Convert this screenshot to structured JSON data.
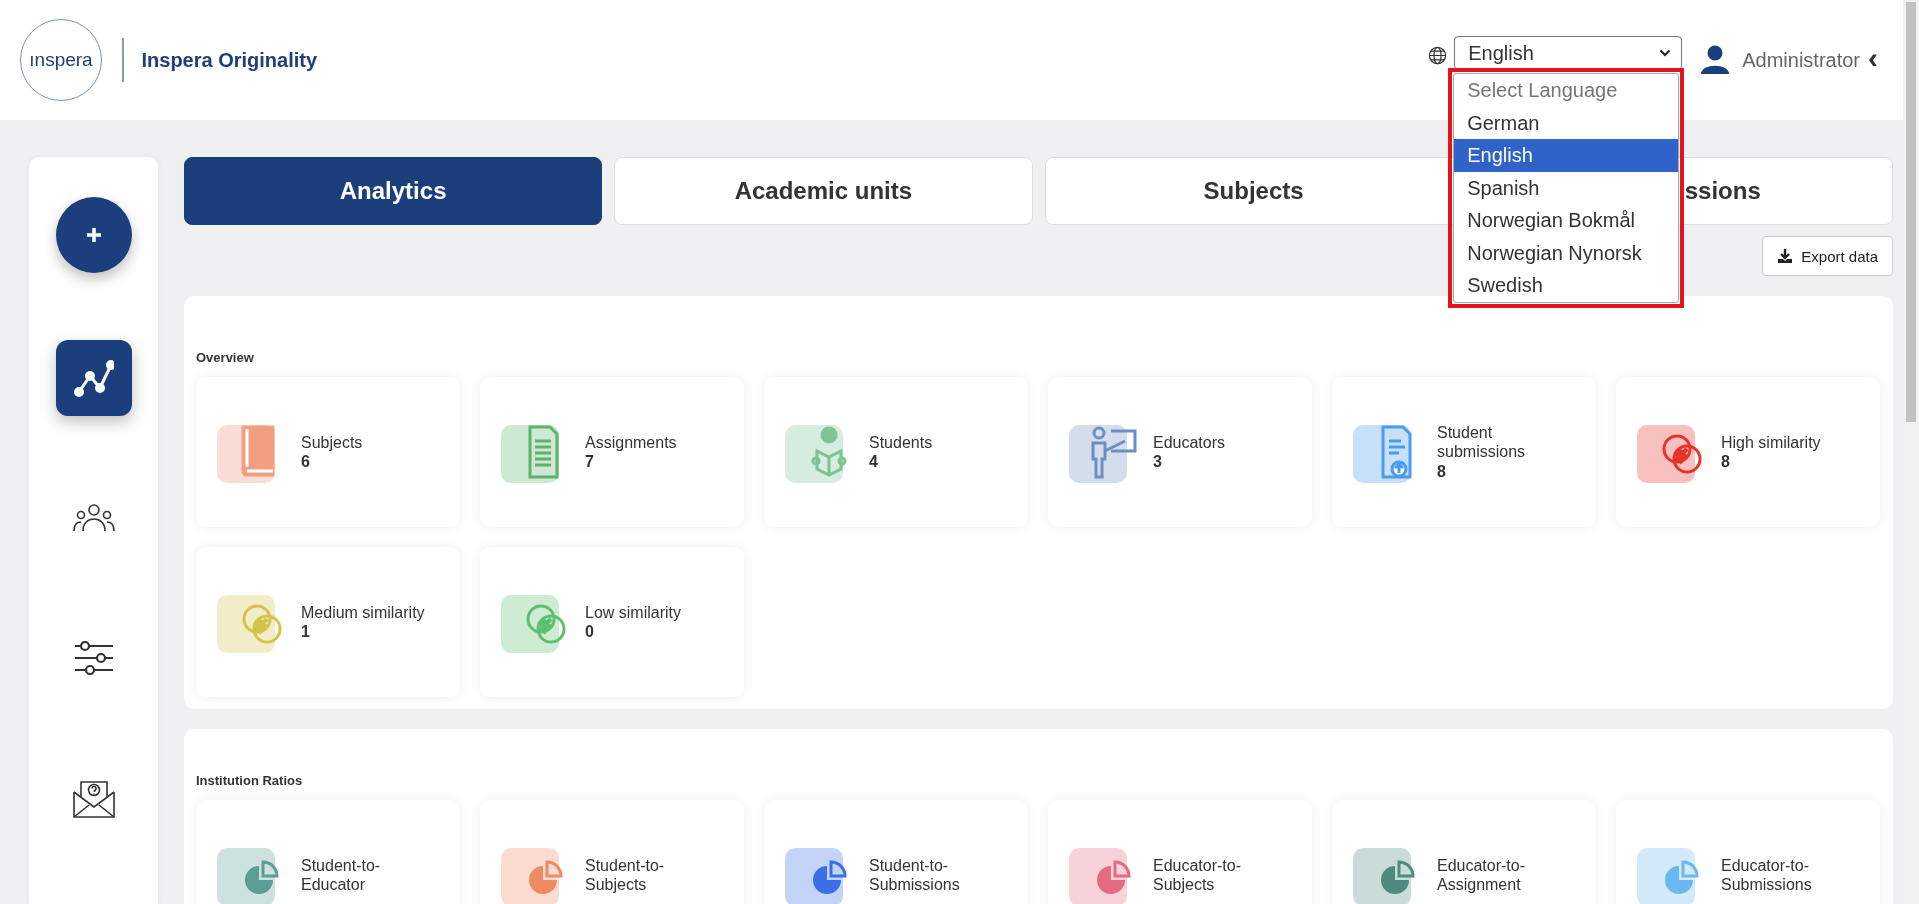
{
  "header": {
    "logo_text": "ınspera",
    "title": "Inspera Originality"
  },
  "language": {
    "value": "English",
    "expanded": true,
    "highlighted": true,
    "options": [
      {
        "label": "Select Language",
        "disabled": true,
        "selected": false
      },
      {
        "label": "German",
        "disabled": false,
        "selected": false
      },
      {
        "label": "English",
        "disabled": false,
        "selected": true
      },
      {
        "label": "Spanish",
        "disabled": false,
        "selected": false
      },
      {
        "label": "Norwegian Bokmål",
        "disabled": false,
        "selected": false
      },
      {
        "label": "Norwegian Nynorsk",
        "disabled": false,
        "selected": false
      },
      {
        "label": "Swedish",
        "disabled": false,
        "selected": false
      }
    ]
  },
  "user": {
    "name": "Administrator",
    "chevron": "‹"
  },
  "sidebar": {
    "add_button": {
      "kind": "add"
    },
    "items": [
      {
        "kind": "analytics",
        "selected": true
      },
      {
        "kind": "people",
        "selected": false
      },
      {
        "kind": "settings",
        "selected": false
      },
      {
        "kind": "mail",
        "selected": false
      }
    ]
  },
  "tabs": [
    {
      "label": "Analytics",
      "selected": true
    },
    {
      "label": "Academic units",
      "selected": false
    },
    {
      "label": "Subjects",
      "selected": false
    },
    {
      "label": "ssions",
      "selected": false
    }
  ],
  "export_button": {
    "label": "Export data"
  },
  "overview": {
    "title": "Overview",
    "cards": [
      {
        "label": "Subjects",
        "value": "6",
        "kind": "book",
        "color": "#f09373"
      },
      {
        "label": "Assignments",
        "value": "7",
        "kind": "document",
        "color": "#5db36b"
      },
      {
        "label": "Students",
        "value": "4",
        "kind": "reader",
        "color": "#7cc494"
      },
      {
        "label": "Educators",
        "value": "3",
        "kind": "teacher",
        "color": "#6d8fbf"
      },
      {
        "label": "Student submissions",
        "value": "8",
        "kind": "upload",
        "color": "#4a9af0"
      },
      {
        "label": "High similarity",
        "value": "8",
        "kind": "similarity",
        "color": "#e8322a"
      },
      {
        "label": "Medium similarity",
        "value": "1",
        "kind": "similarity",
        "color": "#d4c24a"
      },
      {
        "label": "Low similarity",
        "value": "0",
        "kind": "similarity",
        "color": "#5cc070"
      }
    ]
  },
  "institution_ratios": {
    "title": "Institution Ratios",
    "cards": [
      {
        "label": "Student-to-Educator",
        "kind": "pie",
        "color": "#5a9e94"
      },
      {
        "label": "Student-to-Subjects",
        "kind": "pie",
        "color": "#ef8a63"
      },
      {
        "label": "Student-to-Submissions",
        "kind": "pie",
        "color": "#3b6fe8"
      },
      {
        "label": "Educator-to-Subjects",
        "kind": "pie",
        "color": "#e56b82"
      },
      {
        "label": "Educator-to-Assignment",
        "kind": "pie",
        "color": "#4f8a80"
      },
      {
        "label": "Educator-to-Submissions",
        "kind": "pie",
        "color": "#6bb8f0"
      }
    ]
  }
}
